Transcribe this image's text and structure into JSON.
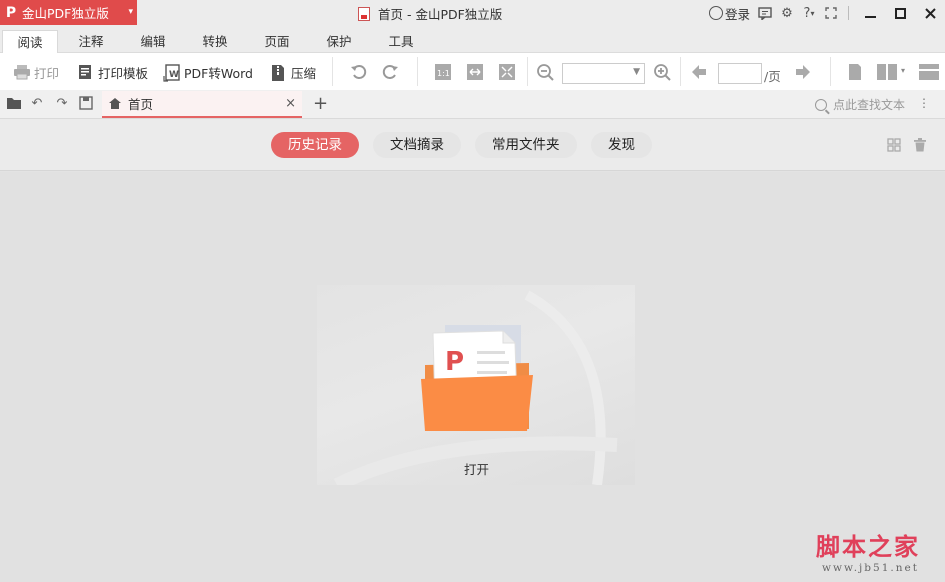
{
  "app": {
    "name": "金山PDF独立版",
    "logo_glyph": "P",
    "window_title": "首页 - 金山PDF独立版",
    "accent": "#e56464",
    "brand_red": "#e04b4b"
  },
  "titlebar": {
    "login_label": "登录",
    "help_label": "?"
  },
  "menu": {
    "tabs": [
      "阅读",
      "注释",
      "编辑",
      "转换",
      "页面",
      "保护",
      "工具"
    ],
    "active": "阅读"
  },
  "toolbar": {
    "print_label": "打印",
    "print_template_label": "打印模板",
    "pdf_to_word_label": "PDF转Word",
    "compress_label": "压缩",
    "zoom_value": "",
    "page_value": "",
    "page_suffix": "/页"
  },
  "doc_tabs": {
    "tabs": [
      {
        "label": "首页",
        "active": true
      }
    ],
    "new_tab": "+",
    "close_glyph": "×",
    "search_placeholder": "点此查找文本"
  },
  "home_nav": {
    "items": [
      "历史记录",
      "文档摘录",
      "常用文件夹",
      "发现"
    ],
    "active": "历史记录"
  },
  "content": {
    "open_label": "打开"
  },
  "watermark": {
    "text": "脚本之家",
    "url": "www.jb51.net"
  }
}
